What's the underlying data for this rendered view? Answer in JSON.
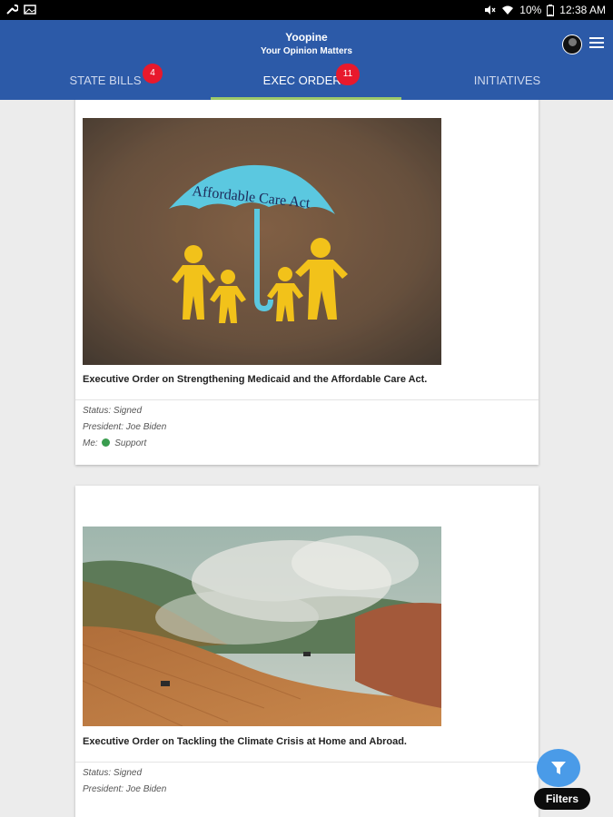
{
  "status_bar": {
    "battery": "10%",
    "time": "12:38 AM",
    "icons": [
      "wrench-icon",
      "image-icon",
      "mute-icon",
      "wifi-icon",
      "battery-icon"
    ]
  },
  "header": {
    "title": "Yoopine",
    "subtitle": "Your Opinion Matters"
  },
  "tabs": [
    {
      "label": "STATE BILLS",
      "badge": "4"
    },
    {
      "label": "EXEC ORDERS",
      "badge": "11",
      "active": true
    },
    {
      "label": "INITIATIVES"
    }
  ],
  "colors": {
    "app_bar": "#2c5aa8",
    "tab_indicator": "#9dc96a",
    "badge": "#e8192c",
    "support_dot": "#3a9d4f",
    "fab": "#4a9be8"
  },
  "cards": [
    {
      "image_text": "Affordable Care Act",
      "title": "Executive Order on Strengthening Medicaid and the Affordable Care Act.",
      "status": "Status: Signed",
      "president": "President: Joe Biden",
      "me_prefix": "Me:",
      "me_value": "Support"
    },
    {
      "title": "Executive Order on Tackling the Climate Crisis at Home and Abroad.",
      "status": "Status: Signed",
      "president": "President: Joe Biden"
    }
  ],
  "filters": {
    "label": "Filters"
  }
}
